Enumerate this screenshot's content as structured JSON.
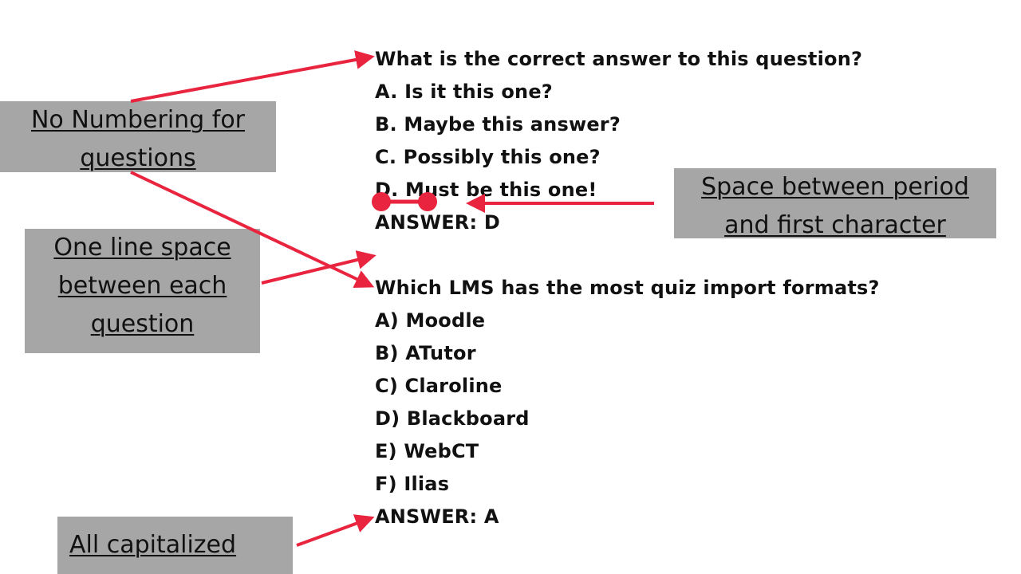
{
  "colors": {
    "arrow": "#e8243f",
    "note_bg": "#a6a6a6",
    "text": "#111111"
  },
  "question1": {
    "question": "What is the correct answer to this question?",
    "options": [
      "A. Is it this one?",
      "B. Maybe this answer?",
      "C. Possibly this one?",
      "D. Must be this one!"
    ],
    "answer": "ANSWER: D"
  },
  "question2": {
    "question": "Which LMS has the most quiz import formats?",
    "options": [
      "A) Moodle",
      "B) ATutor",
      "C) Claroline",
      "D) Blackboard",
      "E) WebCT",
      "F) Ilias"
    ],
    "answer": "ANSWER: A"
  },
  "notes": {
    "no_numbering": [
      "No Numbering for",
      "questions"
    ],
    "one_line_space": [
      "One line space",
      "between each",
      "question"
    ],
    "space_period": [
      "Space between period",
      "and first character"
    ],
    "all_caps": [
      "All capitalized"
    ]
  }
}
